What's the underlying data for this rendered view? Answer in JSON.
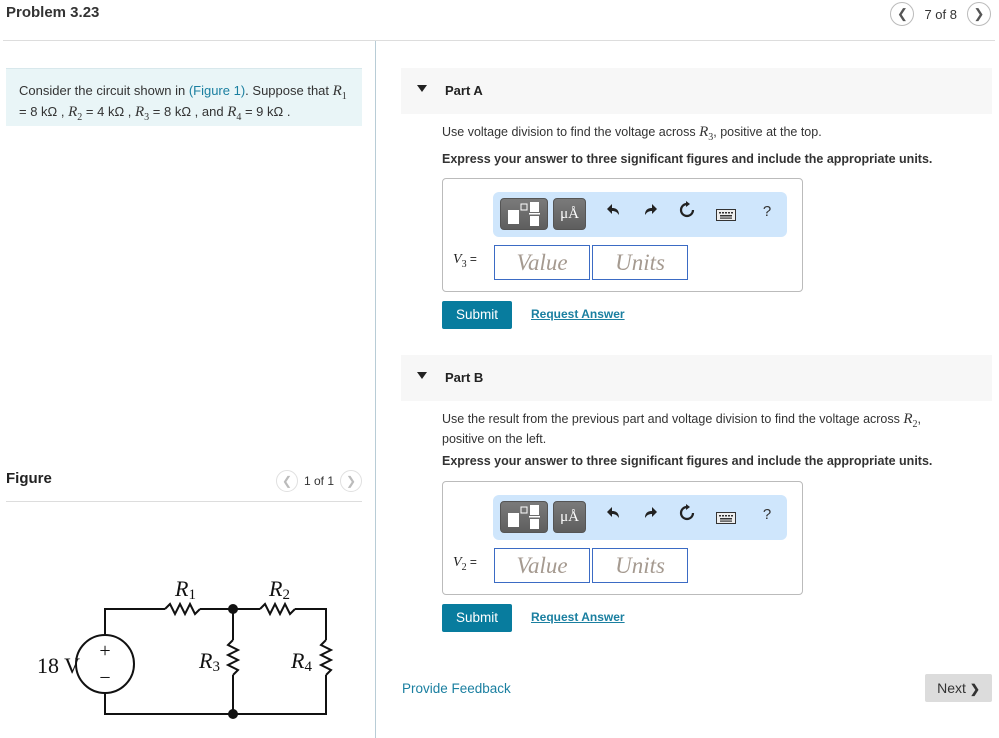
{
  "header": {
    "title": "Problem 3.23",
    "pager": {
      "text": "7 of 8",
      "prev_icon": "chevron-left-icon",
      "next_icon": "chevron-right-icon"
    }
  },
  "intro": {
    "prefix": "Consider the circuit shown in ",
    "figure_link": "(Figure 1)",
    "mid": ". Suppose that ",
    "r1_sym": "R",
    "r1_sub": "1",
    "r1_val": " = 8  kΩ , ",
    "r2_sym": "R",
    "r2_sub": "2",
    "r2_val": " = 4  kΩ , ",
    "r3_sym": "R",
    "r3_sub": "3",
    "r3_val": " = 8  kΩ , and ",
    "r4_sym": "R",
    "r4_sub": "4",
    "r4_val": " = 9  kΩ ."
  },
  "figure": {
    "title": "Figure",
    "pager_text": "1 of 1",
    "circuit": {
      "source_label": "18 V",
      "source_plus": "+",
      "source_minus": "−",
      "r1": "R",
      "r1_sub": "1",
      "r2": "R",
      "r2_sub": "2",
      "r3": "R",
      "r3_sub": "3",
      "r4": "R",
      "r4_sub": "4"
    }
  },
  "parts": [
    {
      "label": "Part A",
      "instruction_prefix": "Use voltage division to find the voltage across ",
      "instruction_sym": "R",
      "instruction_sub": "3",
      "instruction_suffix": ", positive at the top.",
      "express": "Express your answer to three significant figures and include the appropriate units.",
      "var_sym": "V",
      "var_sub": "3",
      "var_eq": " =",
      "value_placeholder": "Value",
      "units_placeholder": "Units",
      "submit": "Submit",
      "request": "Request Answer"
    },
    {
      "label": "Part B",
      "instruction_prefix": "Use the result from the previous part and voltage division to find the voltage across ",
      "instruction_sym": "R",
      "instruction_sub": "2",
      "instruction_suffix": ",",
      "instruction_line2": "positive on the left.",
      "express": "Express your answer to three significant figures and include the appropriate units.",
      "var_sym": "V",
      "var_sub": "2",
      "var_eq": " =",
      "value_placeholder": "Value",
      "units_placeholder": "Units",
      "submit": "Submit",
      "request": "Request Answer"
    }
  ],
  "toolbar": {
    "units_label": "μÅ",
    "help_label": "?",
    "undo_glyph": "↶",
    "redo_glyph": "↷",
    "reset_glyph": "↻",
    "keyboard_glyph": "⌨"
  },
  "footer": {
    "feedback": "Provide Feedback",
    "next": "Next",
    "next_glyph": "❯"
  },
  "colors": {
    "accent": "#087c9e",
    "link": "#1a7fa0",
    "intro_bg": "#e9f5f7",
    "toolbar_bg": "#cfe6fc",
    "input_border": "#3b6bc4"
  }
}
